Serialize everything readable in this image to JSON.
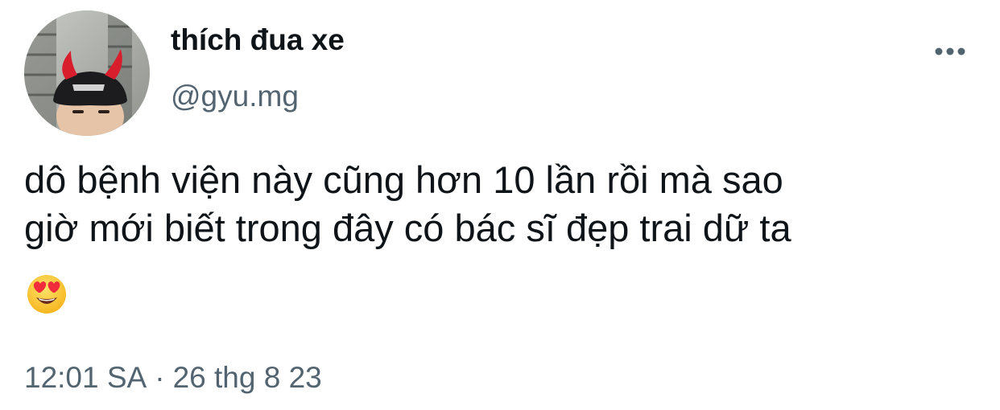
{
  "tweet": {
    "author": {
      "display_name": "thích đua xe",
      "handle": "@gyu.mg",
      "avatar": "profile-photo-devil-horns"
    },
    "text": "dô bệnh viện này cũng hơn 10 lần rồi mà sao\ngiờ mới biết trong đây có bác sĩ đẹp trai dữ ta",
    "emoji": "😍",
    "time": "12:01 SA",
    "separator": "·",
    "date": "26 thg 8 23",
    "more_icon": "ellipsis-horizontal-icon"
  },
  "colors": {
    "text_primary": "#0f1419",
    "text_secondary": "#536471",
    "background": "#ffffff"
  }
}
